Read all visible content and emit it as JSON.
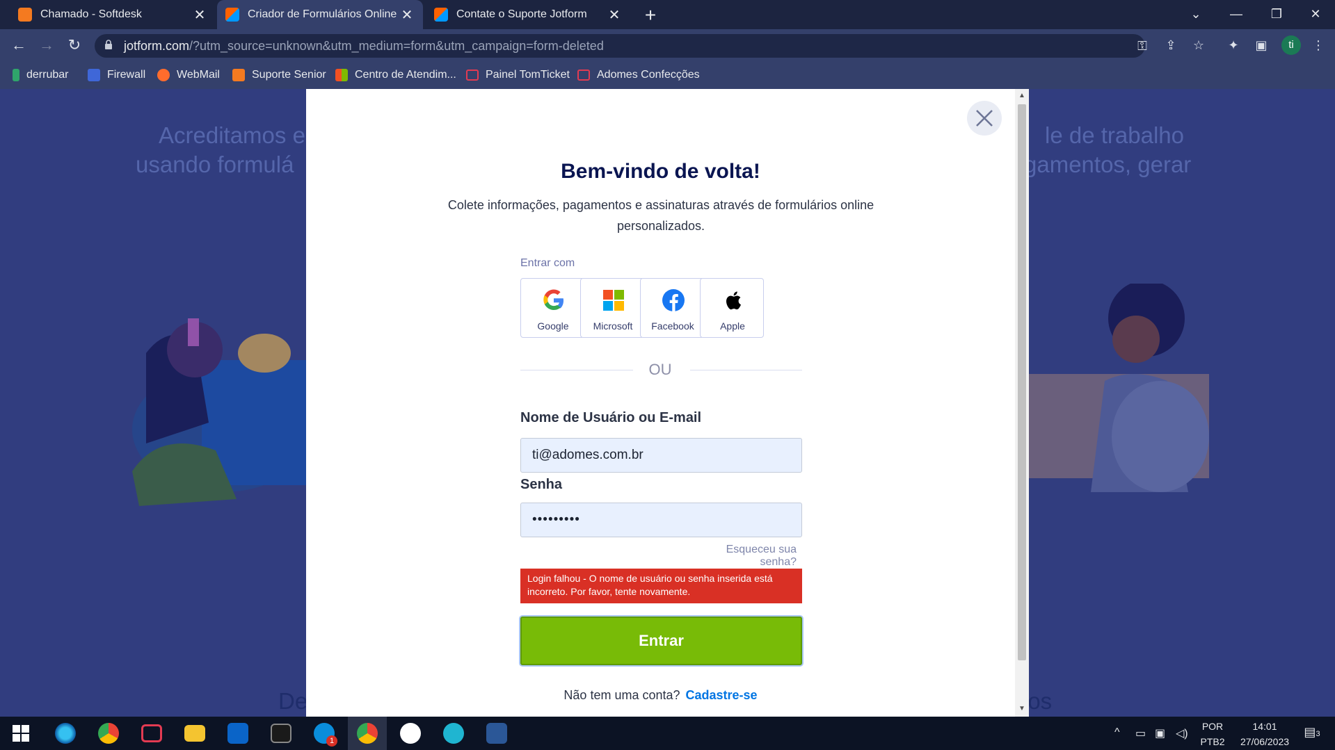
{
  "tabs": [
    {
      "title": "Chamado - Softdesk",
      "color": "#f47a20"
    },
    {
      "title": "Criador de Formulários Online Gr",
      "color": "#ff6100",
      "active": true
    },
    {
      "title": "Contate o Suporte Jotform",
      "color": "#ff6100"
    }
  ],
  "address_bar": {
    "domain": "jotform.com",
    "path": "/?utm_source=unknown&utm_medium=form&utm_campaign=form-deleted"
  },
  "profile_initial": "ti",
  "bookmarks": [
    {
      "label": "derrubar",
      "color": "#2fa56b"
    },
    {
      "label": "Firewall",
      "color": "#3f67d8"
    },
    {
      "label": "WebMail",
      "color": "#ff6c2c"
    },
    {
      "label": "Suporte Senior",
      "color": "#f47a20"
    },
    {
      "label": "Centro de Atendim...",
      "color": "#f25022"
    },
    {
      "label": "Painel TomTicket",
      "color": "#e33b52"
    },
    {
      "label": "Adomes Confecções",
      "color": "#e33b52"
    }
  ],
  "background": {
    "line1_left": "Acreditamos e",
    "line2_left": "usando formulá",
    "line1_right": "le de trabalho",
    "line2_right": "gamentos, gerar",
    "bottom_left": "De",
    "bottom_right": "ios"
  },
  "login": {
    "title": "Bem-vindo de volta!",
    "subtitle": "Colete informações, pagamentos e assinaturas através de formulários online personalizados.",
    "enter_with": "Entrar com",
    "providers": [
      "Google",
      "Microsoft",
      "Facebook",
      "Apple"
    ],
    "or": "OU",
    "username_label": "Nome de Usuário ou E-mail",
    "username_value": "ti@adomes.com.br",
    "password_label": "Senha",
    "password_value": "•••••••••",
    "forgot": "Esqueceu sua senha?",
    "error": "Login falhou - O nome de usuário ou senha inserida está incorreto. Por favor, tente novamente.",
    "submit": "Entrar",
    "no_account": "Não tem uma conta?",
    "signup": "Cadastre-se"
  },
  "taskbar": {
    "lang": "POR",
    "layout": "PTB2",
    "time": "14:01",
    "date": "27/06/2023",
    "notifications": "3",
    "badge": "1"
  },
  "colors": {
    "accent_green": "#78bb07",
    "error_red": "#d93025",
    "link_blue": "#0075e3",
    "title_navy": "#0a1551"
  }
}
